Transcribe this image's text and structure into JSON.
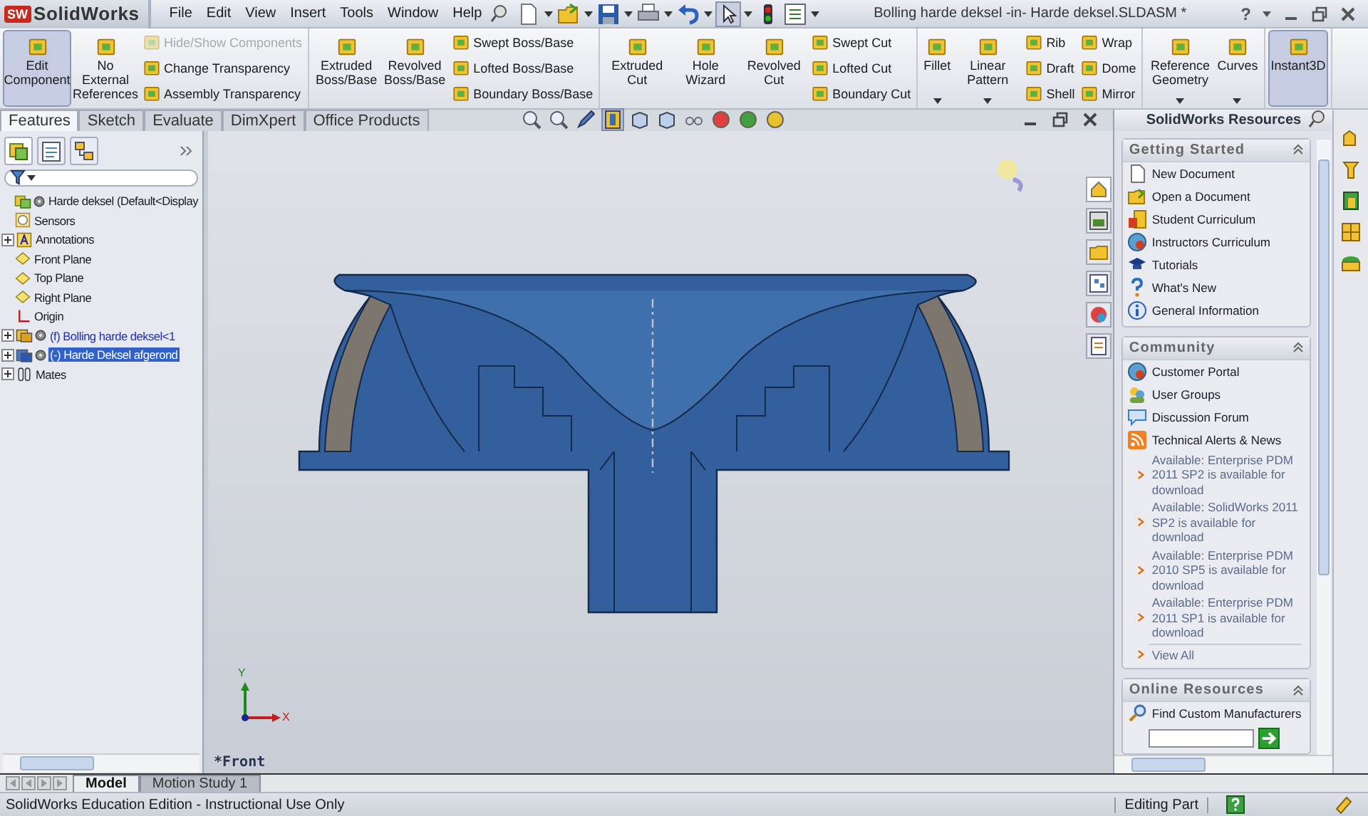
{
  "app": {
    "logo_badge": "SW",
    "logo": "SolidWorks"
  },
  "menu": [
    "File",
    "Edit",
    "View",
    "Insert",
    "Tools",
    "Window",
    "Help"
  ],
  "window": {
    "title": "Bolling harde deksel -in- Harde deksel.SLDASM *",
    "help": "?"
  },
  "command_manager": {
    "groups": [
      {
        "columns": [
          {
            "kind": "large",
            "label": "Edit Component",
            "selected": true,
            "dropdown": false
          },
          {
            "kind": "large",
            "label": "No External References",
            "selected": false,
            "dropdown": false
          },
          {
            "kind": "stack",
            "items": [
              {
                "label": "Hide/Show Components",
                "disabled": true
              },
              {
                "label": "Change Transparency",
                "disabled": false
              },
              {
                "label": "Assembly Transparency",
                "disabled": false
              }
            ]
          }
        ]
      },
      {
        "columns": [
          {
            "kind": "large",
            "label": "Extruded Boss/Base",
            "selected": false,
            "dropdown": false
          },
          {
            "kind": "large",
            "label": "Revolved Boss/Base",
            "selected": false,
            "dropdown": false
          },
          {
            "kind": "stack",
            "items": [
              {
                "label": "Swept Boss/Base",
                "disabled": false
              },
              {
                "label": "Lofted Boss/Base",
                "disabled": false
              },
              {
                "label": "Boundary Boss/Base",
                "disabled": false
              }
            ]
          }
        ]
      },
      {
        "columns": [
          {
            "kind": "large",
            "label": "Extruded Cut",
            "selected": false,
            "dropdown": false
          },
          {
            "kind": "large",
            "label": "Hole Wizard",
            "selected": false,
            "dropdown": false
          },
          {
            "kind": "large",
            "label": "Revolved Cut",
            "selected": false,
            "dropdown": false
          },
          {
            "kind": "stack",
            "items": [
              {
                "label": "Swept Cut",
                "disabled": false
              },
              {
                "label": "Lofted Cut",
                "disabled": false
              },
              {
                "label": "Boundary Cut",
                "disabled": false
              }
            ]
          }
        ]
      },
      {
        "columns": [
          {
            "kind": "large",
            "label": "Fillet",
            "selected": false,
            "dropdown": true
          },
          {
            "kind": "large",
            "label": "Linear Pattern",
            "selected": false,
            "dropdown": true
          },
          {
            "kind": "stack",
            "items": [
              {
                "label": "Rib",
                "disabled": false
              },
              {
                "label": "Draft",
                "disabled": false
              },
              {
                "label": "Shell",
                "disabled": false
              }
            ]
          },
          {
            "kind": "stack",
            "items": [
              {
                "label": "Wrap",
                "disabled": false
              },
              {
                "label": "Dome",
                "disabled": false
              },
              {
                "label": "Mirror",
                "disabled": false
              }
            ]
          }
        ]
      },
      {
        "columns": [
          {
            "kind": "large",
            "label": "Reference Geometry",
            "selected": false,
            "dropdown": true
          },
          {
            "kind": "large",
            "label": "Curves",
            "selected": false,
            "dropdown": true
          }
        ]
      },
      {
        "columns": [
          {
            "kind": "large",
            "label": "Instant3D",
            "selected": true,
            "dropdown": false
          }
        ]
      }
    ]
  },
  "manager_tabs": [
    {
      "label": "Features",
      "selected": true
    },
    {
      "label": "Sketch",
      "selected": false
    },
    {
      "label": "Evaluate",
      "selected": false
    },
    {
      "label": "DimXpert",
      "selected": false
    },
    {
      "label": "Office Products",
      "selected": false
    }
  ],
  "feature_tree": {
    "items": [
      {
        "label": "Harde deksel (Default<Display",
        "kind": "assembly",
        "collapsed": false,
        "selected": false,
        "editing": false,
        "children": [
          {
            "label": "Sensors",
            "kind": "sensors",
            "collapsed": false,
            "selected": false,
            "editing": false
          },
          {
            "label": "Annotations",
            "kind": "annotations",
            "collapsed": true,
            "selected": false,
            "editing": false
          },
          {
            "label": "Front Plane",
            "kind": "plane",
            "collapsed": false,
            "selected": false,
            "editing": false
          },
          {
            "label": "Top Plane",
            "kind": "plane",
            "collapsed": false,
            "selected": false,
            "editing": false
          },
          {
            "label": "Right Plane",
            "kind": "plane",
            "collapsed": false,
            "selected": false,
            "editing": false
          },
          {
            "label": "Origin",
            "kind": "origin",
            "collapsed": false,
            "selected": false,
            "editing": false
          },
          {
            "label": "(f) Bolling harde deksel<1",
            "kind": "component",
            "collapsed": true,
            "selected": false,
            "editing": true
          },
          {
            "label": "(-) Harde Deksel afgerond",
            "kind": "component",
            "collapsed": true,
            "selected": true,
            "editing": false
          },
          {
            "label": "Mates",
            "kind": "mates",
            "collapsed": true,
            "selected": false,
            "editing": false
          }
        ]
      }
    ]
  },
  "viewport": {
    "view_name": "*Front",
    "x_axis": "X",
    "y_axis": "Y"
  },
  "task_pane": {
    "title": "SolidWorks Resources",
    "sections": [
      {
        "title": "Getting Started",
        "kind": "links",
        "items": [
          {
            "label": "New Document",
            "kind": "document"
          },
          {
            "label": "Open a Document",
            "kind": "folder"
          },
          {
            "label": "Student Curriculum",
            "kind": "book"
          },
          {
            "label": "Instructors Curriculum",
            "kind": "globe"
          },
          {
            "label": "Tutorials",
            "kind": "cap"
          },
          {
            "label": "What's New",
            "kind": "question"
          },
          {
            "label": "General Information",
            "kind": "info"
          }
        ]
      },
      {
        "title": "Community",
        "kind": "news",
        "items": [
          {
            "label": "Customer Portal",
            "kind": "globe"
          },
          {
            "label": "User Groups",
            "kind": "people"
          },
          {
            "label": "Discussion Forum",
            "kind": "chat"
          },
          {
            "label": "Technical Alerts & News",
            "kind": "rss"
          }
        ],
        "news": [
          "Available: Enterprise PDM 2011 SP2 is available for download",
          "Available: SolidWorks 2011 SP2 is available for download",
          "Available: Enterprise PDM 2010 SP5 is available for download",
          "Available: Enterprise PDM 2011 SP1 is available for download"
        ],
        "view_all": "View All"
      },
      {
        "title": "Online Resources",
        "kind": "search",
        "items": [
          {
            "label": "Find Custom Manufacturers",
            "kind": "search"
          }
        ]
      }
    ]
  },
  "bottom_tabs": [
    {
      "label": "Model",
      "selected": true
    },
    {
      "label": "Motion Study 1",
      "selected": false
    }
  ],
  "status_bar": {
    "message": "SolidWorks Education Edition - Instructional Use Only",
    "mode": "Editing Part"
  }
}
